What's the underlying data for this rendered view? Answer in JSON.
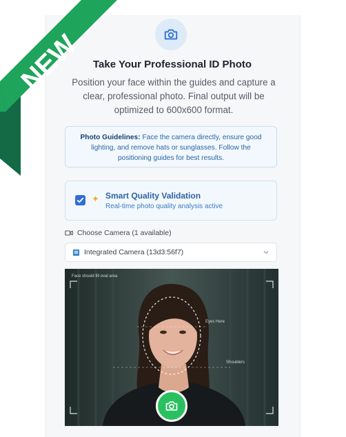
{
  "header": {
    "title": "Take Your Professional ID Photo",
    "subtitle": "Position your face within the guides and capture a clear, professional photo. Final output will be optimized to 600x600 format."
  },
  "guidelines": {
    "label": "Photo Guidelines:",
    "text": " Face the camera directly, ensure good lighting, and remove hats or sunglasses. Follow the positioning guides for best results."
  },
  "validation": {
    "checked": true,
    "title": "Smart Quality Validation",
    "subtitle": "Real-time photo quality analysis active"
  },
  "camera": {
    "label": "Choose Camera (1 available)",
    "selected": "Integrated Camera (13d3:56f7)"
  },
  "preview": {
    "top_left_text": "Face should fill oval area",
    "eyes_label": "Eyes Here",
    "shoulders_label": "Shoulders"
  },
  "ribbon": {
    "text": "NEW",
    "color": "#1fa45b"
  },
  "colors": {
    "accent": "#2f6fd6",
    "capture": "#2bc05f"
  },
  "icons": [
    "camera-icon",
    "checkbox-checked-icon",
    "sparkle-icon",
    "video-camera-icon",
    "chevron-down-icon",
    "webcam-icon",
    "capture-camera-icon"
  ]
}
